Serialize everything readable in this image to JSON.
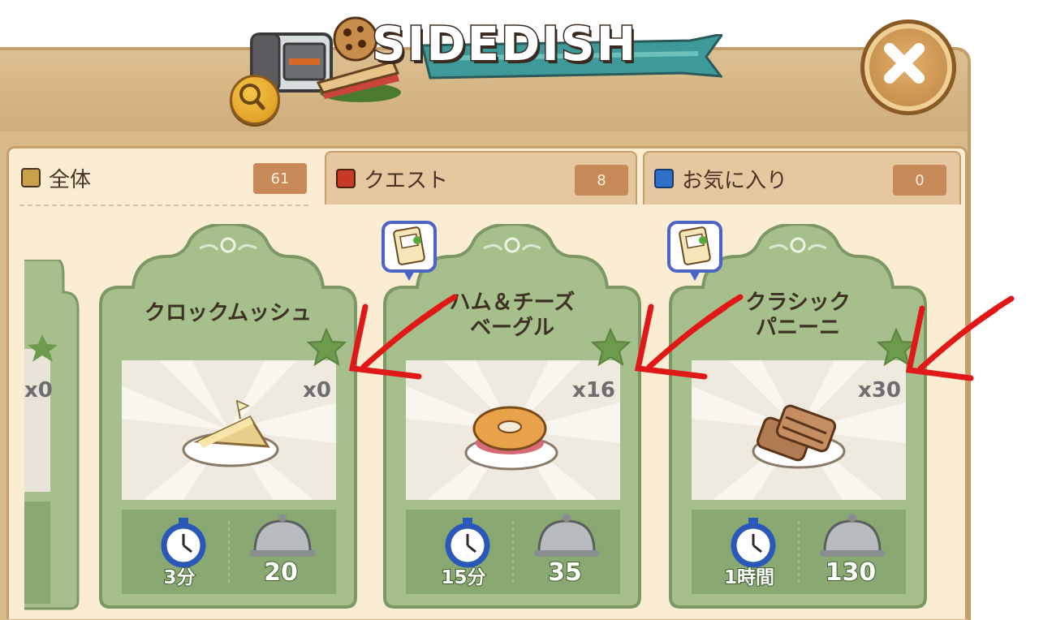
{
  "window": {
    "title": "SIDEDISH"
  },
  "icons": {
    "help": "help-magnifier-icon",
    "close": "close-x-icon",
    "tab_all": "list-book-icon",
    "tab_quest": "exclamation-icon",
    "tab_fav": "star-icon",
    "time": "stopwatch-icon",
    "price": "serving-cloche-icon",
    "favorite": "green-star-icon",
    "recipe": "recipe-card-icon",
    "annotation": "red-arrow-annotation"
  },
  "tabs": [
    {
      "label": "全体",
      "count": "61",
      "active": true
    },
    {
      "label": "クエスト",
      "count": "8",
      "active": false
    },
    {
      "label": "お気に入り",
      "count": "0",
      "active": false
    }
  ],
  "partial_card": {
    "qty": "x0"
  },
  "cards": [
    {
      "name": "クロックムッシュ",
      "qty": "x0",
      "time": "3分",
      "price": "20",
      "recipe_badge": false,
      "dish": "sandwich-slice"
    },
    {
      "name": "ハム＆チーズベーグル",
      "name_lines": [
        "ハム＆チーズ",
        "ベーグル"
      ],
      "qty": "x16",
      "time": "15分",
      "price": "35",
      "recipe_badge": true,
      "dish": "bagel"
    },
    {
      "name": "クラシックパニーニ",
      "name_lines": [
        "クラシック",
        "パニーニ"
      ],
      "qty": "x30",
      "time": "1時間",
      "price": "130",
      "recipe_badge": true,
      "dish": "panini"
    }
  ],
  "colors": {
    "card_green": "#a6bf8c",
    "card_green_dark": "#8aa872",
    "annotation_red": "#e01818",
    "frame_tan": "#d8b98a",
    "panel_cream": "#fbecd4",
    "tab_count_bg": "#c88a58"
  }
}
